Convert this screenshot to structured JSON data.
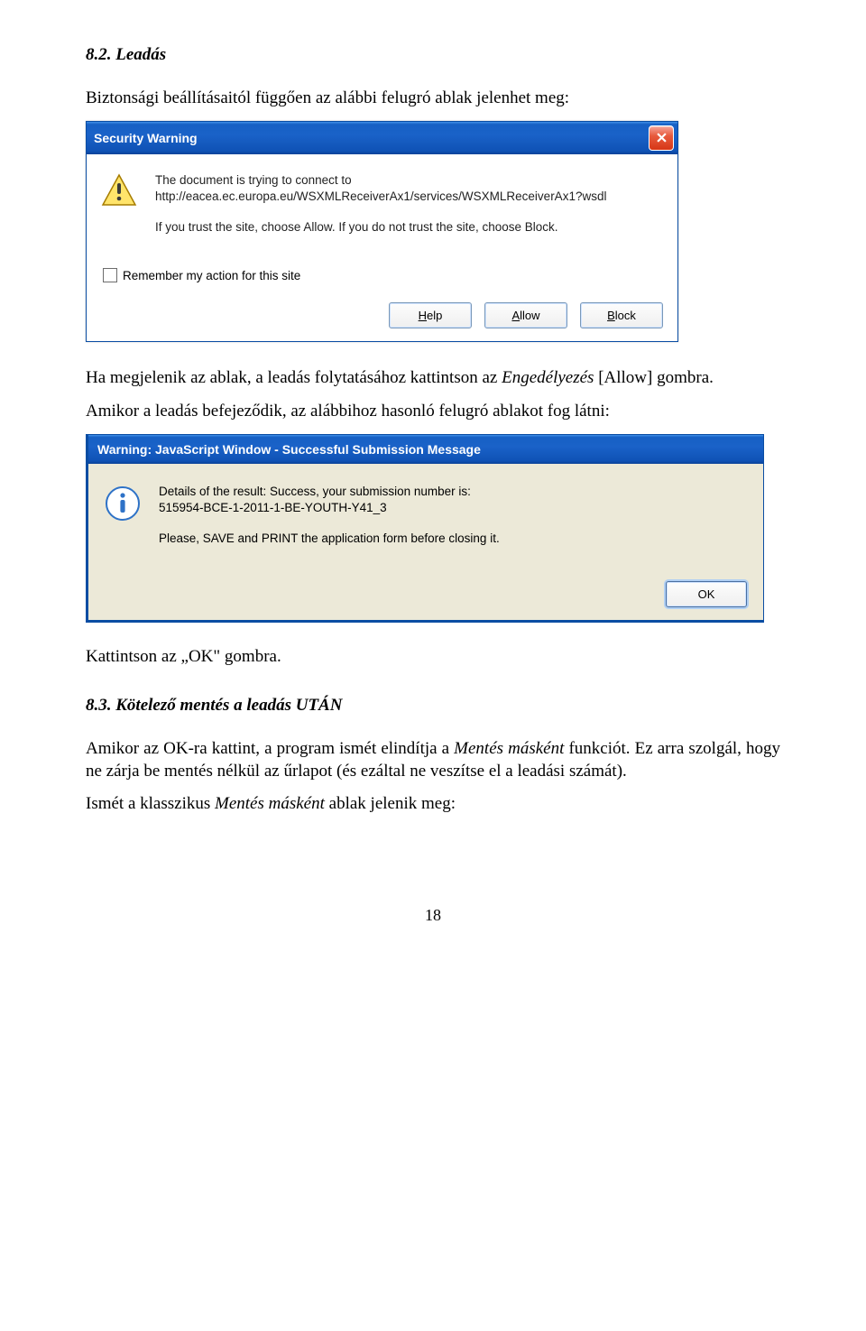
{
  "section": {
    "heading1": "8.2. Leadás",
    "intro1": "Biztonsági beállításaitól függően az alábbi felugró ablak jelenhet meg:",
    "after_dialog1_prefix": "Ha megjelenik az ablak, a leadás folytatásához kattintson az ",
    "after_dialog1_italic": "Engedélyezés",
    "after_dialog1_suffix": " [Allow] gombra.",
    "after_dialog1_line2": "Amikor a leadás befejeződik, az alábbihoz hasonló felugró ablakot fog látni:",
    "click_ok": "Kattintson az „OK\" gombra.",
    "heading2": "8.3. Kötelező mentés a leadás UTÁN",
    "para2_prefix": "Amikor az OK-ra kattint, a program ismét elindítja a ",
    "para2_italic": "Mentés másként",
    "para2_suffix": " funkciót. Ez arra szolgál, hogy ne zárja be mentés nélkül az űrlapot (és ezáltal ne veszítse el a leadási számát).",
    "para3_prefix": "Ismét a klasszikus ",
    "para3_italic": "Mentés másként",
    "para3_suffix": " ablak jelenik meg:"
  },
  "dialog1": {
    "title": "Security Warning",
    "line1": "The document is trying to connect to",
    "line2": "http://eacea.ec.europa.eu/WSXMLReceiverAx1/services/WSXMLReceiverAx1?wsdl",
    "line3": "If you trust the site, choose Allow. If you do not trust the site, choose Block.",
    "remember": "Remember my action for this site",
    "help_pre": "",
    "help_u": "H",
    "help_post": "elp",
    "allow_pre": "",
    "allow_u": "A",
    "allow_post": "llow",
    "block_pre": "",
    "block_u": "B",
    "block_post": "lock"
  },
  "dialog2": {
    "title": "Warning: JavaScript Window - Successful Submission Message",
    "line1": "Details of the result: Success, your submission number is:",
    "line2": "515954-BCE-1-2011-1-BE-YOUTH-Y41_3",
    "line3": "Please, SAVE and PRINT the application form before closing it.",
    "ok": "OK"
  },
  "page_number": "18"
}
